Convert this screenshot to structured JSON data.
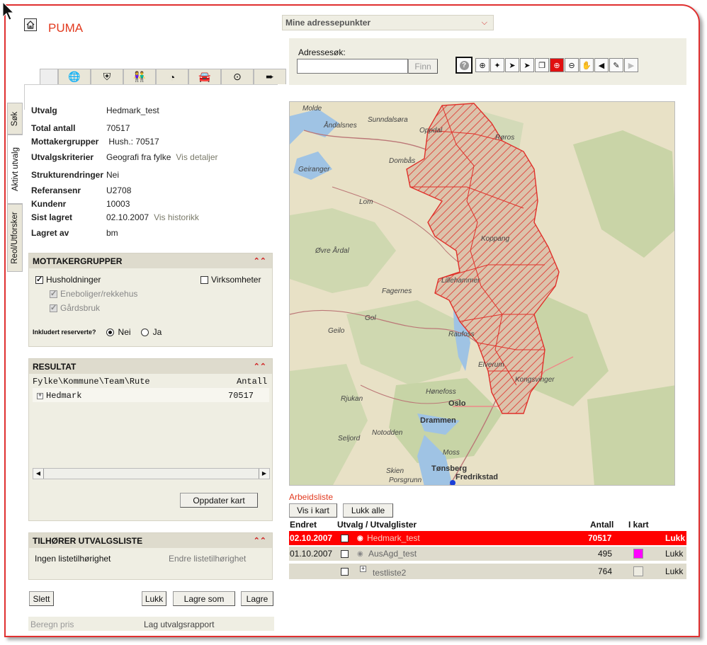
{
  "app": {
    "title": "PUMA"
  },
  "top": {
    "dropdown_label": "Mine adressepunkter",
    "address_search_label": "Adressesøk:",
    "address_search_value": "",
    "find_button": "Finn"
  },
  "map_tools": [
    "help-icon",
    "pan-center-icon",
    "select-area-icon",
    "select-add-icon",
    "select-icon",
    "select-rect-icon",
    "zoom-in-icon",
    "zoom-out-icon",
    "pan-hand-icon",
    "previous-icon",
    "measure-icon",
    "next-icon"
  ],
  "vertical_tabs": [
    "Søk",
    "Aktivt utvalg",
    "Reol/Utforsker"
  ],
  "top_tabs": [
    "globe-icon",
    "shield-icon",
    "people-icon",
    "pie-chart-icon",
    "car-icon",
    "target-icon",
    "export-icon"
  ],
  "utvalg": {
    "rows": [
      {
        "label": "Utvalg",
        "value": "Hedmark_test",
        "link": ""
      },
      {
        "label": "Total antall",
        "value": "70517",
        "link": ""
      },
      {
        "label": "Mottakergrupper",
        "value": " Hush.: 70517",
        "link": ""
      },
      {
        "label": "Utvalgskriterier",
        "value": "Geografi fra fylke",
        "link": "Vis detaljer"
      },
      {
        "label": "Strukturendringer",
        "value": "Nei",
        "link": ""
      },
      {
        "label": "Referansenr",
        "value": "U2708",
        "link": ""
      },
      {
        "label": "Kundenr",
        "value": "10003",
        "link": ""
      },
      {
        "label": "Sist lagret",
        "value": "02.10.2007",
        "link": "Vis historikk"
      },
      {
        "label": "Lagret av",
        "value": "bm",
        "link": ""
      }
    ]
  },
  "mottakergrupper": {
    "title": "MOTTAKERGRUPPER",
    "husholdninger": "Husholdninger",
    "eneboliger": "Eneboliger/rekkehus",
    "gardsbruk": "Gårdsbruk",
    "virksomheter": "Virksomheter",
    "reserved_label": "Inkludert reserverte?",
    "reserved_no": "Nei",
    "reserved_yes": "Ja"
  },
  "resultat": {
    "title": "RESULTAT",
    "col_path": "Fylke\\Kommune\\Team\\Rute",
    "col_count": "Antall",
    "rows": [
      {
        "name": "Hedmark",
        "count": "70517"
      }
    ],
    "update_button": "Oppdater kart"
  },
  "utvalgsliste": {
    "title": "TILHØRER UTVALGSLISTE",
    "status": "Ingen listetilhørighet",
    "change_link": "Endre listetilhørighet"
  },
  "bottom_buttons": {
    "delete": "Slett",
    "close": "Lukk",
    "save_as": "Lagre som",
    "save": "Lagre"
  },
  "footer": {
    "price": "Beregn pris",
    "report": "Lag utvalgsrapport"
  },
  "map": {
    "labels": [
      {
        "text": "Molde",
        "cls": ""
      },
      {
        "text": "Åndalsnes",
        "cls": ""
      },
      {
        "text": "Sunndalsøra",
        "cls": ""
      },
      {
        "text": "Oppdal",
        "cls": ""
      },
      {
        "text": "Røros",
        "cls": ""
      },
      {
        "text": "Geiranger",
        "cls": ""
      },
      {
        "text": "Dombås",
        "cls": ""
      },
      {
        "text": "Lom",
        "cls": ""
      },
      {
        "text": "Øvre Årdal",
        "cls": ""
      },
      {
        "text": "Koppang",
        "cls": ""
      },
      {
        "text": "Lillehammer",
        "cls": ""
      },
      {
        "text": "Fagernes",
        "cls": ""
      },
      {
        "text": "Gol",
        "cls": ""
      },
      {
        "text": "Geilo",
        "cls": ""
      },
      {
        "text": "Raufoss",
        "cls": ""
      },
      {
        "text": "Elverum",
        "cls": ""
      },
      {
        "text": "Kongsvinger",
        "cls": ""
      },
      {
        "text": "Hønefoss",
        "cls": ""
      },
      {
        "text": "Rjukan",
        "cls": ""
      },
      {
        "text": "Oslo",
        "cls": "city"
      },
      {
        "text": "Drammen",
        "cls": "city"
      },
      {
        "text": "Notodden",
        "cls": ""
      },
      {
        "text": "Seljord",
        "cls": ""
      },
      {
        "text": "Moss",
        "cls": ""
      },
      {
        "text": "Skien",
        "cls": ""
      },
      {
        "text": "Porsgrunn",
        "cls": ""
      },
      {
        "text": "Tønsberg",
        "cls": "city"
      },
      {
        "text": "Fredrikstad",
        "cls": "city"
      }
    ]
  },
  "arbeidsliste": {
    "title": "Arbeidsliste",
    "show_button": "Vis i kart",
    "close_all_button": "Lukk alle",
    "headers": {
      "changed": "Endret",
      "name": "Utvalg / Utvalglister",
      "count": "Antall",
      "inmap": "I kart"
    },
    "rows": [
      {
        "date": "02.10.2007",
        "name": "Hedmark_test",
        "count": "70517",
        "action": "Lukk",
        "color": "#ff0000"
      },
      {
        "date": "01.10.2007",
        "name": "AusAgd_test",
        "count": "495",
        "action": "Lukk",
        "color": "#ff00ff"
      },
      {
        "date": "",
        "name": "testliste2",
        "count": "764",
        "action": "Lukk",
        "color": ""
      }
    ]
  },
  "colors": {
    "accent": "#e23a1f",
    "highlight_row": "#ff0000",
    "panel_bg": "#efeee3",
    "panel_head": "#dedbcd"
  }
}
